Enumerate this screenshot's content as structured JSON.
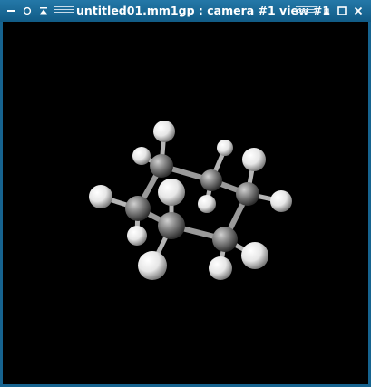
{
  "window": {
    "title": "untitled01.mm1gp : camera #1 view #1",
    "frame_color": "#16638f",
    "viewport_background": "#000000"
  },
  "titlebar": {
    "left_buttons": [
      {
        "name": "minimize-icon",
        "glyph": "–"
      },
      {
        "name": "circle-icon",
        "glyph": "○"
      },
      {
        "name": "shade-icon",
        "glyph": "⩯"
      }
    ],
    "right_buttons": [
      {
        "name": "iconify-icon",
        "glyph": "▫"
      },
      {
        "name": "maximize-icon",
        "glyph": "□"
      },
      {
        "name": "close-icon",
        "glyph": "✕"
      }
    ]
  },
  "molecule": {
    "description_visible": false,
    "carbon_color": "#8a8a8a",
    "hydrogen_color": "#f2f2f2",
    "atoms": [
      {
        "id": "C1",
        "element": "C"
      },
      {
        "id": "C2",
        "element": "C"
      },
      {
        "id": "C3",
        "element": "C"
      },
      {
        "id": "C4",
        "element": "C"
      },
      {
        "id": "C5",
        "element": "C"
      },
      {
        "id": "C6",
        "element": "C"
      },
      {
        "id": "H1",
        "element": "H"
      },
      {
        "id": "H2",
        "element": "H"
      },
      {
        "id": "H3",
        "element": "H"
      },
      {
        "id": "H4",
        "element": "H"
      },
      {
        "id": "H5",
        "element": "H"
      },
      {
        "id": "H6",
        "element": "H"
      },
      {
        "id": "H7",
        "element": "H"
      },
      {
        "id": "H8",
        "element": "H"
      },
      {
        "id": "H9",
        "element": "H"
      },
      {
        "id": "H10",
        "element": "H"
      },
      {
        "id": "H11",
        "element": "H"
      },
      {
        "id": "H12",
        "element": "H"
      }
    ]
  }
}
